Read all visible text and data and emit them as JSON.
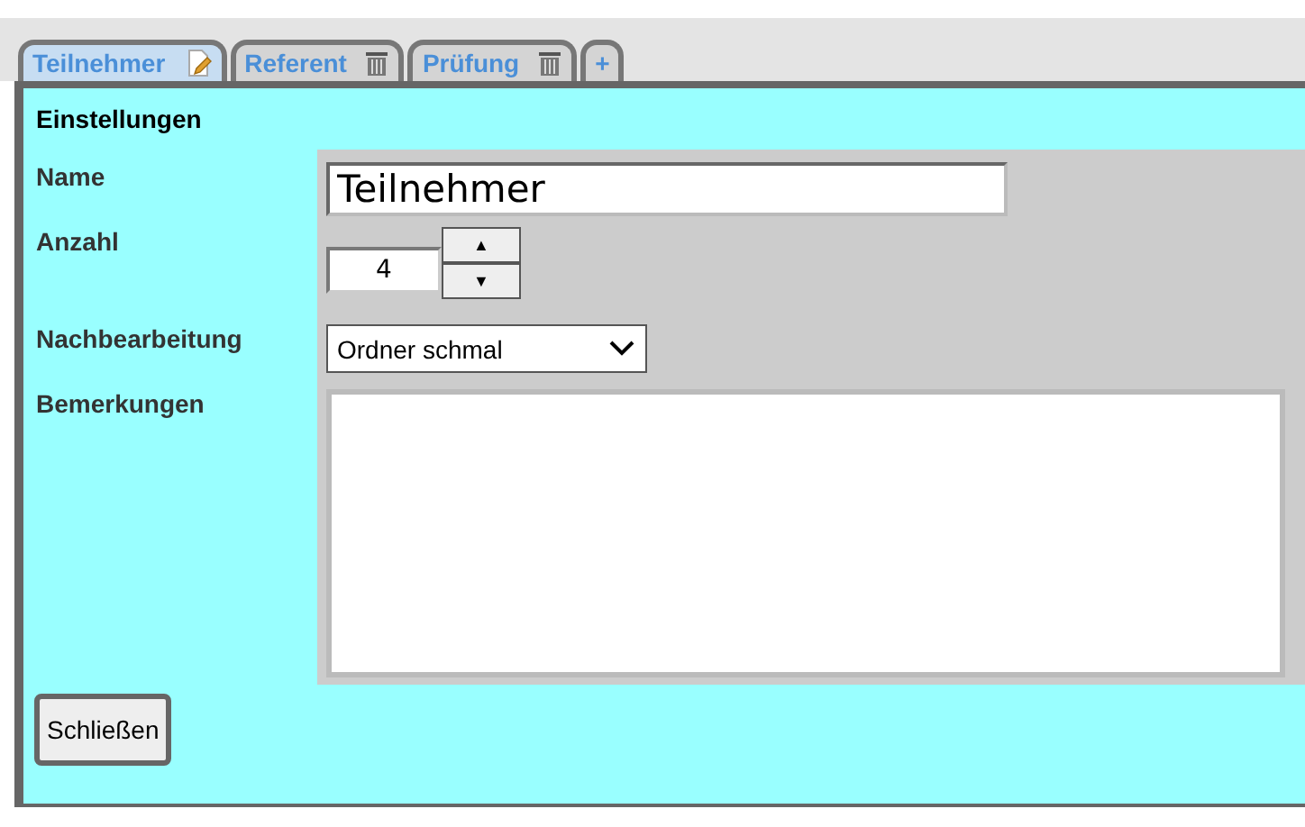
{
  "tabs": [
    {
      "label": "Teilnehmer",
      "selected": true,
      "kind": "edit"
    },
    {
      "label": "Referent",
      "selected": false,
      "kind": "trash"
    },
    {
      "label": "Prüfung",
      "selected": false,
      "kind": "trash"
    },
    {
      "label": "+",
      "selected": false,
      "kind": "add"
    }
  ],
  "section_title": "Einstellungen",
  "fields": [
    {
      "label": "Name",
      "kind": "text",
      "value": "Teilnehmer"
    },
    {
      "label": "Anzahl",
      "kind": "spinner",
      "value": "4",
      "up": "▲",
      "down": "▼"
    },
    {
      "label": "Nachbearbeitung",
      "kind": "select",
      "value": "Ordner schmal"
    },
    {
      "label": "Bemerkungen",
      "kind": "textarea"
    }
  ],
  "close_button": "Schließen"
}
